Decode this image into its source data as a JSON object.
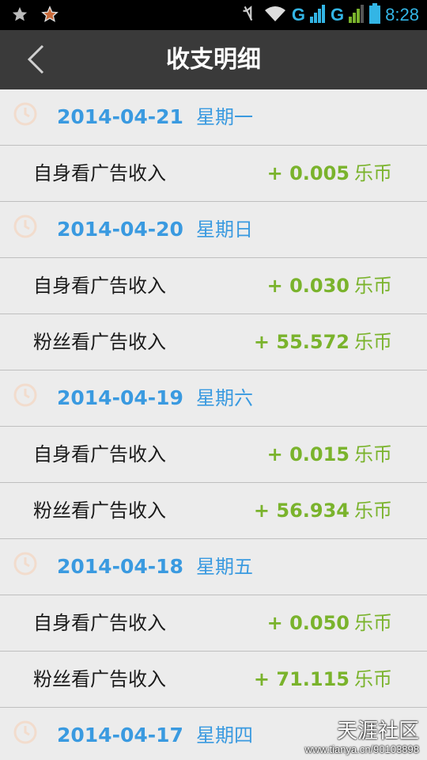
{
  "status_bar": {
    "time": "8:28",
    "network1": "G",
    "network2": "G",
    "icons": [
      "star-icon",
      "star-outline-icon",
      "mute-icon",
      "wifi-icon",
      "signal-icon",
      "battery-icon"
    ]
  },
  "header": {
    "title": "收支明细",
    "back_icon": "chevron-left-icon"
  },
  "colors": {
    "date": "#3a9ae0",
    "amount": "#7ab32c",
    "header_bg": "#3a3a3a",
    "clock": "#f2dccd"
  },
  "rows": [
    {
      "date": "2014-04-21",
      "weekday": "星期一"
    },
    {
      "label": "自身看广告收入",
      "amount": "+ 0.005",
      "unit": "乐币"
    },
    {
      "date": "2014-04-20",
      "weekday": "星期日"
    },
    {
      "label": "自身看广告收入",
      "amount": "+ 0.030",
      "unit": "乐币"
    },
    {
      "label": "粉丝看广告收入",
      "amount": "+ 55.572",
      "unit": "乐币"
    },
    {
      "date": "2014-04-19",
      "weekday": "星期六"
    },
    {
      "label": "自身看广告收入",
      "amount": "+ 0.015",
      "unit": "乐币"
    },
    {
      "label": "粉丝看广告收入",
      "amount": "+ 56.934",
      "unit": "乐币"
    },
    {
      "date": "2014-04-18",
      "weekday": "星期五"
    },
    {
      "label": "自身看广告收入",
      "amount": "+ 0.050",
      "unit": "乐币"
    },
    {
      "label": "粉丝看广告收入",
      "amount": "+ 71.115",
      "unit": "乐币"
    },
    {
      "date": "2014-04-17",
      "weekday": "星期四"
    }
  ],
  "watermark": {
    "title": "天涯社区",
    "url": "www.tianya.cn/90103898"
  }
}
